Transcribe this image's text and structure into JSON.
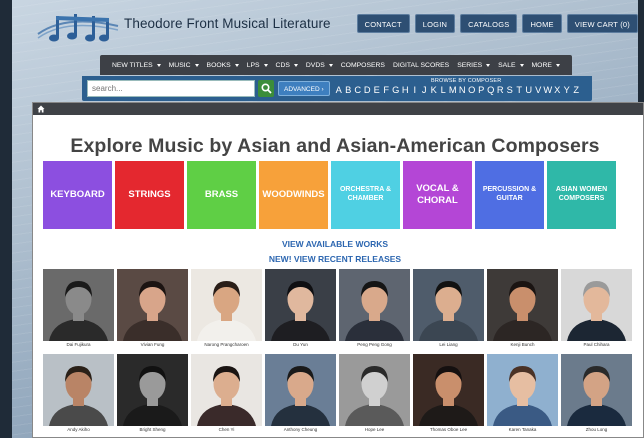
{
  "site": {
    "title": "Theodore Front Musical Literature"
  },
  "top_nav": [
    {
      "label": "CONTACT"
    },
    {
      "label": "LOGIN"
    },
    {
      "label": "CATALOGS"
    },
    {
      "label": "HOME"
    },
    {
      "label": "VIEW CART (0)"
    }
  ],
  "main_nav": [
    {
      "label": "NEW TITLES",
      "dropdown": true
    },
    {
      "label": "MUSIC",
      "dropdown": true
    },
    {
      "label": "BOOKS",
      "dropdown": true
    },
    {
      "label": "LPS",
      "dropdown": true
    },
    {
      "label": "CDS",
      "dropdown": true
    },
    {
      "label": "DVDS",
      "dropdown": true
    },
    {
      "label": "COMPOSERS",
      "dropdown": false
    },
    {
      "label": "DIGITAL SCORES",
      "dropdown": false
    },
    {
      "label": "SERIES",
      "dropdown": true
    },
    {
      "label": "SALE",
      "dropdown": true
    },
    {
      "label": "MORE",
      "dropdown": true
    }
  ],
  "search": {
    "placeholder": "search...",
    "advanced_label": "ADVANCED ›"
  },
  "browse": {
    "label": "BROWSE BY COMPOSER",
    "letters": [
      "A",
      "B",
      "C",
      "D",
      "E",
      "F",
      "G",
      "H",
      "I",
      "J",
      "K",
      "L",
      "M",
      "N",
      "O",
      "P",
      "Q",
      "R",
      "S",
      "T",
      "U",
      "V",
      "W",
      "X",
      "Y",
      "Z"
    ]
  },
  "page": {
    "title": "Explore Music by Asian and Asian-American Composers",
    "link_available": "VIEW AVAILABLE WORKS",
    "link_recent": "NEW! VIEW RECENT RELEASES"
  },
  "categories": [
    {
      "label": "KEYBOARD",
      "color": "#8c4fe0"
    },
    {
      "label": "STRINGS",
      "color": "#e4282f"
    },
    {
      "label": "BRASS",
      "color": "#5fcf45"
    },
    {
      "label": "WOODWINDS",
      "color": "#f7a13a"
    },
    {
      "label": "ORCHESTRA & CHAMBER",
      "color": "#4fd0e3"
    },
    {
      "label": "VOCAL & CHORAL",
      "color": "#b446d6"
    },
    {
      "label": "PERCUSSION & GUITAR",
      "color": "#4f6ee3"
    },
    {
      "label": "ASIAN WOMEN COMPOSERS",
      "color": "#2fb8a8"
    }
  ],
  "composers": [
    {
      "name": "Dai Fujikura",
      "bg": "#6a6a6a",
      "skin": "#8a8a8a",
      "hair": "#1a1a1a",
      "shirt": "#2a2a2a"
    },
    {
      "name": "Vivian Fung",
      "bg": "#5a4a44",
      "skin": "#d8a58a",
      "hair": "#1c1412",
      "shirt": "#3a2e2a"
    },
    {
      "name": "Narong Prangcharoen",
      "bg": "#ece8e2",
      "skin": "#d9a682",
      "hair": "#2a1e18",
      "shirt": "#f2f0ec"
    },
    {
      "name": "Du Yun",
      "bg": "#3a3f47",
      "skin": "#e0b89e",
      "hair": "#0f0f12",
      "shirt": "#1e1e22"
    },
    {
      "name": "Peng Peng Gong",
      "bg": "#5e6570",
      "skin": "#d9a98b",
      "hair": "#151515",
      "shirt": "#2a2f3a"
    },
    {
      "name": "Lei Liang",
      "bg": "#4f5c6b",
      "skin": "#dcae8f",
      "hair": "#121212",
      "shirt": "#3b4652"
    },
    {
      "name": "Kenji Bunch",
      "bg": "#3e3a38",
      "skin": "#c98f6c",
      "hair": "#1a1412",
      "shirt": "#2c2624"
    },
    {
      "name": "Paul Chihara",
      "bg": "#d8d8d8",
      "skin": "#e3b89b",
      "hair": "#9a9a9a",
      "shirt": "#1c2633"
    },
    {
      "name": "Andy Akiho",
      "bg": "#b9c0c6",
      "skin": "#b98466",
      "hair": "#2a2018",
      "shirt": "#4a4a4a"
    },
    {
      "name": "Bright Sheng",
      "bg": "#2a2a2a",
      "skin": "#9a9a9a",
      "hair": "#111111",
      "shirt": "#1a1a1a"
    },
    {
      "name": "Chen Yi",
      "bg": "#e9e6e2",
      "skin": "#dcae8f",
      "hair": "#1a1412",
      "shirt": "#3a2a2a"
    },
    {
      "name": "Anthony Cheung",
      "bg": "#6a7e96",
      "skin": "#d9a98b",
      "hair": "#1a1a1a",
      "shirt": "#24303e"
    },
    {
      "name": "Hope Lee",
      "bg": "#9a9a9a",
      "skin": "#d0d0d0",
      "hair": "#2a2a2a",
      "shirt": "#5a5a5a"
    },
    {
      "name": "Thomas Oboe Lee",
      "bg": "#3a2a24",
      "skin": "#c98f6c",
      "hair": "#151010",
      "shirt": "#1e1a18"
    },
    {
      "name": "Karen Tanaka",
      "bg": "#8fb0cf",
      "skin": "#e6bea2",
      "hair": "#4a3226",
      "shirt": "#3a5a84"
    },
    {
      "name": "Zhou Long",
      "bg": "#6b7b8c",
      "skin": "#d3a385",
      "hair": "#2a2a2a",
      "shirt": "#1a2a3e"
    }
  ]
}
